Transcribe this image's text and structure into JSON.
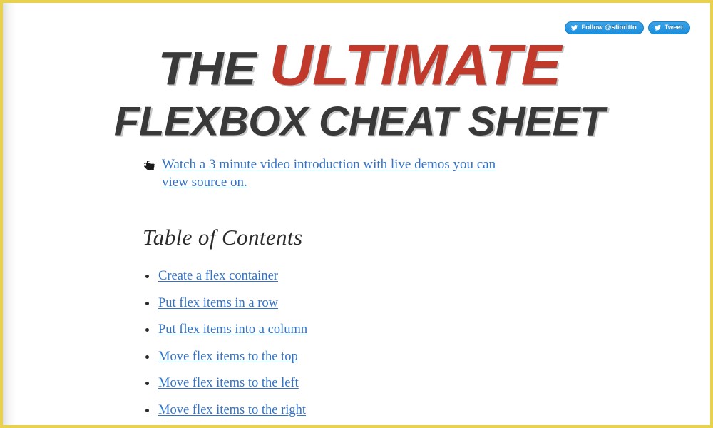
{
  "social": {
    "follow": {
      "label": "Follow @sfioritto",
      "icon": "twitter-bird-icon"
    },
    "tweet": {
      "label": "Tweet",
      "icon": "twitter-bird-icon"
    }
  },
  "masthead": {
    "line1_word1": "THE",
    "line1_word2": "ULTIMATE",
    "line2": "FLEXBOX CHEAT SHEET",
    "color_red": "#c0392b",
    "color_dark": "#39393a"
  },
  "video_callout": {
    "icon": "pointing-hand-icon",
    "link_text": "Watch a 3 minute video introduction with live demos you can view source on."
  },
  "toc": {
    "heading": "Table of Contents",
    "items": [
      {
        "label": "Create a flex container"
      },
      {
        "label": "Put flex items in a row"
      },
      {
        "label": "Put flex items into a column"
      },
      {
        "label": "Move flex items to the top"
      },
      {
        "label": "Move flex items to the left"
      },
      {
        "label": "Move flex items to the right"
      }
    ]
  },
  "theme": {
    "link_color": "#3273c8",
    "frame_color": "#e8d14f",
    "twitter_blue": "#1b8fdd"
  }
}
